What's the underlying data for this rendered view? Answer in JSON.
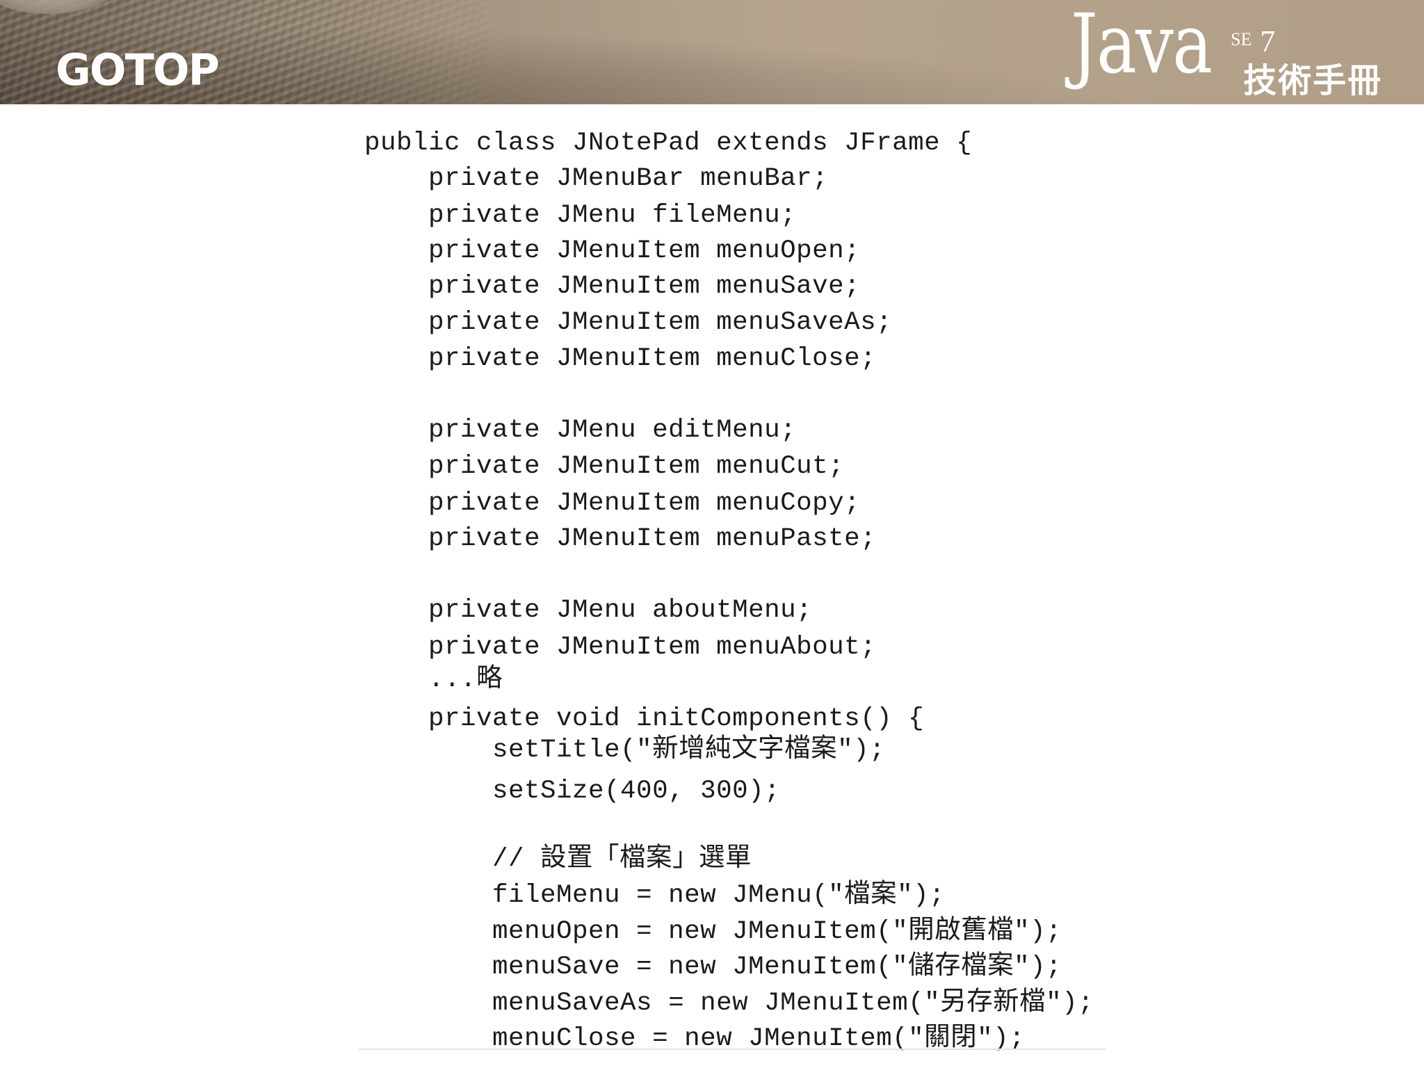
{
  "header": {
    "publisher_logo": "GOTOP",
    "book_title": "Java",
    "book_edition_prefix": "SE",
    "book_edition_number": "7",
    "book_subtitle": "技術手冊"
  },
  "code": {
    "lines": [
      "public class JNotePad extends JFrame {",
      "    private JMenuBar menuBar;",
      "    private JMenu fileMenu;",
      "    private JMenuItem menuOpen;",
      "    private JMenuItem menuSave;",
      "    private JMenuItem menuSaveAs;",
      "    private JMenuItem menuClose;",
      "",
      "    private JMenu editMenu;",
      "    private JMenuItem menuCut;",
      "    private JMenuItem menuCopy;",
      "    private JMenuItem menuPaste;",
      "",
      "    private JMenu aboutMenu;",
      "    private JMenuItem menuAbout;",
      "    ...略",
      "    private void initComponents() {",
      "        setTitle(\"新增純文字檔案\");",
      "        setSize(400, 300);",
      "",
      "        // 設置「檔案」選單",
      "        fileMenu = new JMenu(\"檔案\");",
      "        menuOpen = new JMenuItem(\"開啟舊檔\");",
      "        menuSave = new JMenuItem(\"儲存檔案\");",
      "        menuSaveAs = new JMenuItem(\"另存新檔\");",
      "        menuClose = new JMenuItem(\"關閉\");"
    ]
  }
}
